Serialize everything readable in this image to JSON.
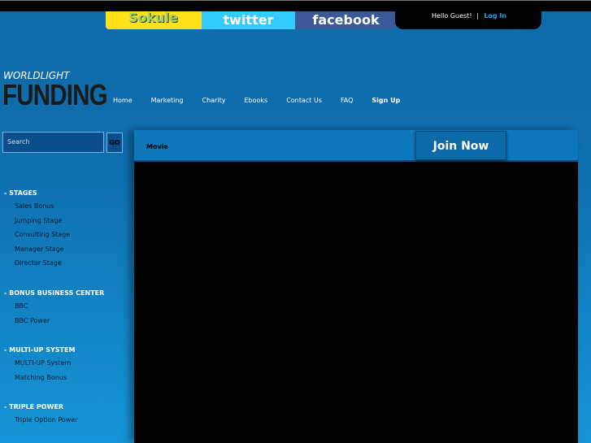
{
  "top": {
    "sokule": "Sokule",
    "twitter": "twitter",
    "facebook": "facebook",
    "greeting": "Hello Guest!",
    "separator": "|",
    "login": "Log In"
  },
  "logo": {
    "line1": "WORLDLIGHT",
    "line2": "FUNDING"
  },
  "nav": [
    "Home",
    "Marketing",
    "Charity",
    "Ebooks",
    "Contact Us",
    "FAQ",
    "Sign Up"
  ],
  "search": {
    "placeholder": "Search",
    "go": "GO"
  },
  "sidebar": [
    {
      "title": "- STAGES",
      "items": [
        "Sales Bonus",
        "Jumping Stage",
        "Consulting Stage",
        "Manager Stage",
        "Director Stage"
      ]
    },
    {
      "title": "- BONUS BUSINESS CENTER",
      "items": [
        "BBC",
        "BBC Power"
      ]
    },
    {
      "title": "- MULTI-UP SYSTEM",
      "items": [
        "MULTI-UP System",
        "Matching Bonus"
      ]
    },
    {
      "title": "- TRIPLE POWER",
      "items": [
        "Triple Option Power"
      ]
    }
  ],
  "main": {
    "title": "Movie",
    "join": "Join Now"
  }
}
